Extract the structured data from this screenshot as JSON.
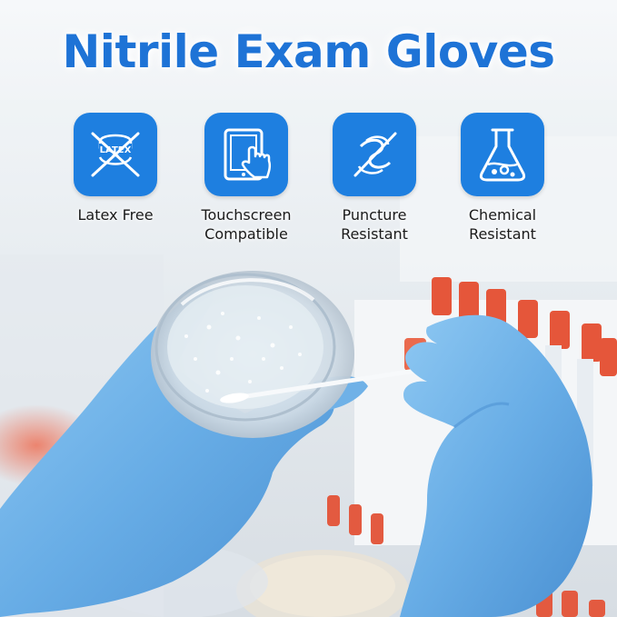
{
  "title": "Nitrile Exam Gloves",
  "colors": {
    "accent": "#1e7fe0",
    "title": "#1e73d6",
    "glove": "#6db3e8",
    "cap": "#e5563a"
  },
  "features": [
    {
      "icon": "no-latex-icon",
      "icon_text": "LATEX",
      "label_lines": [
        "Latex Free"
      ]
    },
    {
      "icon": "touchscreen-icon",
      "label_lines": [
        "Touchscreen",
        "Compatible"
      ]
    },
    {
      "icon": "puncture-icon",
      "label_lines": [
        "Puncture",
        "Resistant"
      ]
    },
    {
      "icon": "flask-icon",
      "label_lines": [
        "Chemical",
        "Resistant"
      ]
    }
  ]
}
